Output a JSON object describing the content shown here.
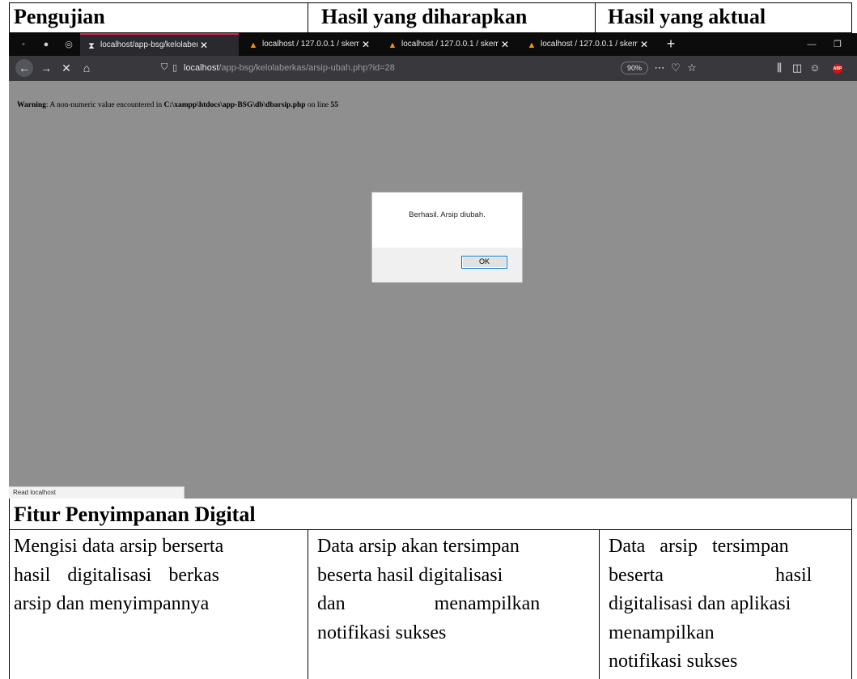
{
  "table": {
    "headers": [
      "Pengujian",
      "Hasil yang diharapkan",
      "Hasil yang aktual"
    ],
    "section_title": "Fitur Penyimpanan Digital",
    "row": {
      "col1": [
        "Mengisi data arsip berserta",
        "hasil digitalisasi berkas",
        "arsip dan menyimpannya"
      ],
      "col2": [
        "Data arsip akan tersimpan",
        "beserta hasil digitalisasi",
        "dan menampilkan",
        "notifikasi sukses"
      ],
      "col3": [
        "Data arsip tersimpan",
        "beserta hasil",
        "digitalisasi dan aplikasi",
        "menampilkan",
        "notifikasi sukses"
      ]
    }
  },
  "browser": {
    "tabs": [
      {
        "icon": "hourglass-icon",
        "label": "localhost/app-bsg/kelolaberka",
        "close": "✕",
        "active": true
      },
      {
        "icon": "phpmyadmin-icon",
        "label": "localhost / 127.0.0.1 / skema_d",
        "close": "✕",
        "active": false
      },
      {
        "icon": "phpmyadmin-icon",
        "label": "localhost / 127.0.0.1 / skema_d",
        "close": "✕",
        "active": false
      },
      {
        "icon": "phpmyadmin-icon",
        "label": "localhost / 127.0.0.1 / skema_d",
        "close": "✕",
        "active": false
      }
    ],
    "new_tab": "+",
    "url": {
      "host": "localhost",
      "path": "/app-bsg/kelolaberkas/arsip-ubah.php?id=28"
    },
    "zoom": "90%",
    "abp_label": "ABP",
    "warning": {
      "prefix": "Warning",
      "text": ": A non-numeric value encountered in ",
      "path": "C:\\xampp\\htdocs\\app-BSG\\db\\dbarsip.php",
      "middle": " on line ",
      "line": "55"
    },
    "dialog": {
      "message": "Berhasil. Arsip diubah.",
      "ok_label": "OK"
    },
    "status": "Read localhost",
    "colors": {
      "tab_accent": "#d7264c",
      "dialog_button_border": "#0078d7",
      "page_background": "#8f8f8f"
    }
  }
}
